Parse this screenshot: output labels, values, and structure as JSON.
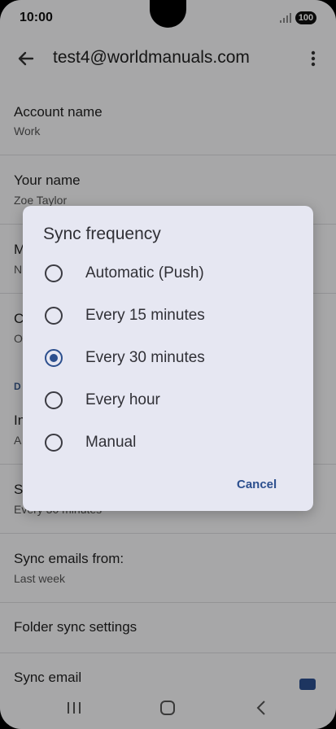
{
  "status": {
    "time": "10:00",
    "battery": "100"
  },
  "header": {
    "title": "test4@worldmanuals.com"
  },
  "rows": [
    {
      "label": "Account name",
      "value": "Work"
    },
    {
      "label": "Your name",
      "value": "Zoe Taylor"
    },
    {
      "label": "M",
      "value": "N"
    },
    {
      "label": "C",
      "value": "O"
    },
    {
      "section": "D"
    },
    {
      "label": "In",
      "value": "A"
    },
    {
      "label": "S",
      "value": "Every 30 minutes"
    },
    {
      "label": "Sync emails from:",
      "value": "Last week"
    },
    {
      "label": "Folder sync settings"
    },
    {
      "label": "Sync email"
    }
  ],
  "dialog": {
    "title": "Sync frequency",
    "options": [
      {
        "label": "Automatic (Push)",
        "selected": false
      },
      {
        "label": "Every 15 minutes",
        "selected": false
      },
      {
        "label": "Every 30 minutes",
        "selected": true
      },
      {
        "label": "Every hour",
        "selected": false
      },
      {
        "label": "Manual",
        "selected": false
      }
    ],
    "cancel": "Cancel"
  },
  "nav": {
    "recents_icon": "recents-icon",
    "home_icon": "home-icon",
    "back_icon": "back-icon"
  }
}
